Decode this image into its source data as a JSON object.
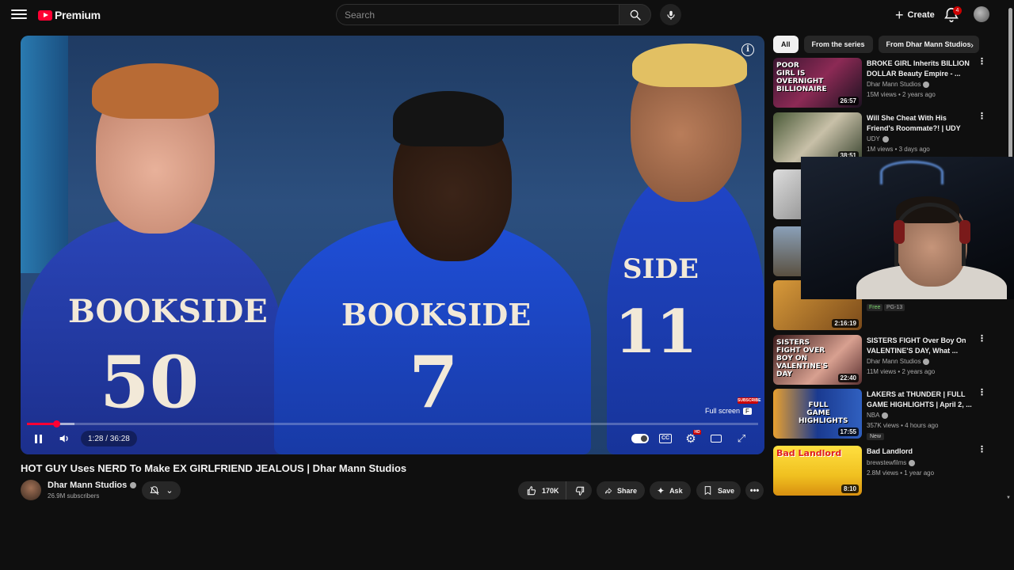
{
  "header": {
    "logo_text": "Premium",
    "search_placeholder": "Search",
    "create_label": "Create",
    "notification_count": "4"
  },
  "player": {
    "time": "1:28 / 36:28",
    "progress_fraction": 0.04,
    "fullscreen_tip": "Full screen",
    "fullscreen_key": "F",
    "subscribe_badge": "SUBSCRIBE",
    "jersey_numbers": [
      "BOOKSIDE",
      "50",
      "BOOKSIDE",
      "7",
      "SIDE",
      "11"
    ]
  },
  "video": {
    "title": "HOT GUY Uses NERD To Make EX GIRLFRIEND JEALOUS | Dhar Mann Studios",
    "channel": "Dhar Mann Studios",
    "subscribers": "26.9M subscribers",
    "likes": "170K",
    "share_label": "Share",
    "ask_label": "Ask",
    "save_label": "Save"
  },
  "sidebar": {
    "chips": [
      "All",
      "From the series",
      "From Dhar Mann Studios"
    ],
    "recommendations": [
      {
        "title": "BROKE GIRL Inherits BILLION DOLLAR Beauty Empire - ...",
        "channel": "Dhar Mann Studios",
        "meta": "15M views • 2 years ago",
        "duration": "26:57",
        "thumb_text": "POOR GIRL IS OVERNIGHT BILLIONAIRE",
        "verified": true
      },
      {
        "title": "Will She Cheat With His Friend's Roommate?! | UDY Loyalty Test",
        "channel": "UDY",
        "meta": "1M views • 3 days ago",
        "duration": "38:51",
        "thumb_text": "",
        "verified": true
      },
      {
        "title": "",
        "channel": "",
        "meta": "",
        "duration": "",
        "thumb_text": ""
      },
      {
        "title": "",
        "channel": "",
        "meta": "",
        "duration": "",
        "thumb_text": ""
      },
      {
        "title": "",
        "channel": "",
        "meta": "",
        "duration": "2:16:19",
        "thumb_text": "",
        "tags": [
          "Free",
          "PG-13"
        ]
      },
      {
        "title": "SISTERS FIGHT Over Boy On VALENTINE'S DAY, What ...",
        "channel": "Dhar Mann Studios",
        "meta": "11M views • 2 years ago",
        "duration": "22:40",
        "thumb_text": "SISTERS FIGHT OVER BOY ON VALENTINE'S DAY",
        "verified": true
      },
      {
        "title": "LAKERS at THUNDER | FULL GAME HIGHLIGHTS | April 2, ...",
        "channel": "NBA",
        "meta": "357K views • 4 hours ago",
        "duration": "17:55",
        "thumb_text": "FULL GAME HIGHLIGHTS",
        "verified": true,
        "badge": "New"
      },
      {
        "title": "Bad Landlord",
        "channel": "brewstewfilms",
        "meta": "2.8M views • 1 year ago",
        "duration": "8:10",
        "thumb_text": "Bad Landlord",
        "verified": true
      }
    ]
  },
  "colors": {
    "accent": "#ff0033",
    "background": "#0f0f0f",
    "pill": "#272727"
  }
}
